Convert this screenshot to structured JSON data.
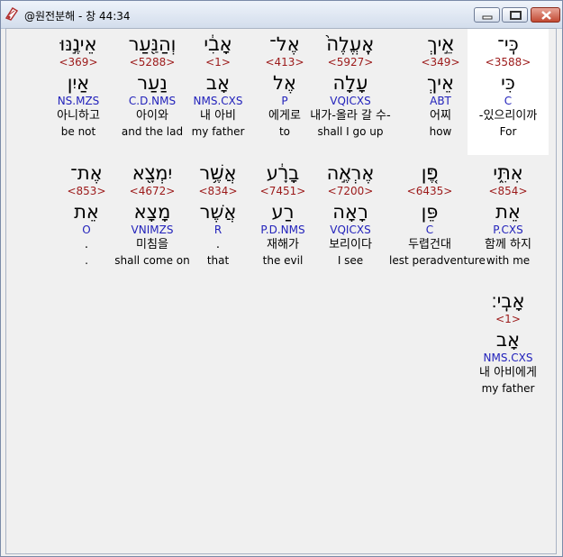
{
  "window": {
    "title": "@원전분해 - 창 44:34"
  },
  "rows": [
    [
      {
        "heb": "כִּֽי־",
        "num": "<3588>",
        "lemma": "כִּי",
        "parse": "C",
        "kor": "-있으리이까",
        "eng": "For",
        "selected": true
      },
      {
        "heb": "אֵ֣יךְ",
        "num": "<349>",
        "lemma": "אֵיךְ",
        "parse": "ABT",
        "kor": "어찌",
        "eng": "how"
      },
      {
        "heb": "אֶֽעֱלֶה֙",
        "num": "<5927>",
        "lemma": "עָלָה",
        "parse": "VQICXS",
        "kor": "내가-올라 갈 수-",
        "eng": "shall I go up"
      },
      {
        "heb": "אֶל־",
        "num": "<413>",
        "lemma": "אֶל",
        "parse": "P",
        "kor": "에게로",
        "eng": "to"
      },
      {
        "heb": "אָבִ֔י",
        "num": "<1>",
        "lemma": "אָב",
        "parse": "NMS.CXS",
        "kor": "내 아비",
        "eng": "my father"
      },
      {
        "heb": "וְהַנַּ֖עַר",
        "num": "<5288>",
        "lemma": "נַעַר",
        "parse": "C.D.NMS",
        "kor": "아이와",
        "eng": "and the lad"
      },
      {
        "heb": "אֵינֶ֣נּוּ",
        "num": "<369>",
        "lemma": "אַיִן",
        "parse": "NS.MZS",
        "kor": "아니하고",
        "eng": "be not"
      }
    ],
    [
      {
        "heb": "אִתִּ֑י",
        "num": "<854>",
        "lemma": "אֵת",
        "parse": "P.CXS",
        "kor": "함께 하지",
        "eng": "with me"
      },
      {
        "heb": "פֶּ֚ן",
        "num": "<6435>",
        "lemma": "פֵּן",
        "parse": "C",
        "kor": "두렵건대",
        "eng": "lest peradventure"
      },
      {
        "heb": "אֶרְאֶ֣ה",
        "num": "<7200>",
        "lemma": "רָאָה",
        "parse": "VQICXS",
        "kor": "보리이다",
        "eng": "I see"
      },
      {
        "heb": "בָרָ֔ע",
        "num": "<7451>",
        "lemma": "רַע",
        "parse": "P.D.NMS",
        "kor": "재해가",
        "eng": "the evil"
      },
      {
        "heb": "אֲשֶׁ֥ר",
        "num": "<834>",
        "lemma": "אֲשֶׁר",
        "parse": "R",
        "kor": ".",
        "eng": "that"
      },
      {
        "heb": "יִמְצָ֖א",
        "num": "<4672>",
        "lemma": "מָצָא",
        "parse": "VNIMZS",
        "kor": "미침을",
        "eng": "shall come on"
      },
      {
        "heb": "אֶת־",
        "num": "<853>",
        "lemma": "אֵת",
        "parse": "O",
        "kor": ".",
        "eng": "."
      }
    ],
    [
      {
        "heb": "אָבִֽי׃",
        "num": "<1>",
        "lemma": "אָב",
        "parse": "NMS.CXS",
        "kor": "내 아비에게",
        "eng": "my father"
      }
    ]
  ]
}
